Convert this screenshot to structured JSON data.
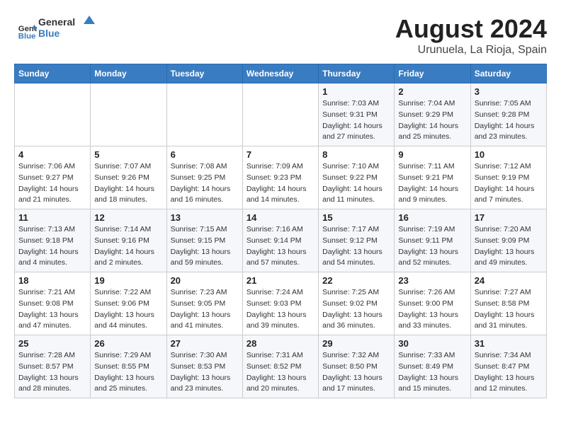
{
  "header": {
    "logo_line1": "General",
    "logo_line2": "Blue",
    "month_year": "August 2024",
    "location": "Urunuela, La Rioja, Spain"
  },
  "weekdays": [
    "Sunday",
    "Monday",
    "Tuesday",
    "Wednesday",
    "Thursday",
    "Friday",
    "Saturday"
  ],
  "weeks": [
    [
      {
        "day": "",
        "info": ""
      },
      {
        "day": "",
        "info": ""
      },
      {
        "day": "",
        "info": ""
      },
      {
        "day": "",
        "info": ""
      },
      {
        "day": "1",
        "info": "Sunrise: 7:03 AM\nSunset: 9:31 PM\nDaylight: 14 hours\nand 27 minutes."
      },
      {
        "day": "2",
        "info": "Sunrise: 7:04 AM\nSunset: 9:29 PM\nDaylight: 14 hours\nand 25 minutes."
      },
      {
        "day": "3",
        "info": "Sunrise: 7:05 AM\nSunset: 9:28 PM\nDaylight: 14 hours\nand 23 minutes."
      }
    ],
    [
      {
        "day": "4",
        "info": "Sunrise: 7:06 AM\nSunset: 9:27 PM\nDaylight: 14 hours\nand 21 minutes."
      },
      {
        "day": "5",
        "info": "Sunrise: 7:07 AM\nSunset: 9:26 PM\nDaylight: 14 hours\nand 18 minutes."
      },
      {
        "day": "6",
        "info": "Sunrise: 7:08 AM\nSunset: 9:25 PM\nDaylight: 14 hours\nand 16 minutes."
      },
      {
        "day": "7",
        "info": "Sunrise: 7:09 AM\nSunset: 9:23 PM\nDaylight: 14 hours\nand 14 minutes."
      },
      {
        "day": "8",
        "info": "Sunrise: 7:10 AM\nSunset: 9:22 PM\nDaylight: 14 hours\nand 11 minutes."
      },
      {
        "day": "9",
        "info": "Sunrise: 7:11 AM\nSunset: 9:21 PM\nDaylight: 14 hours\nand 9 minutes."
      },
      {
        "day": "10",
        "info": "Sunrise: 7:12 AM\nSunset: 9:19 PM\nDaylight: 14 hours\nand 7 minutes."
      }
    ],
    [
      {
        "day": "11",
        "info": "Sunrise: 7:13 AM\nSunset: 9:18 PM\nDaylight: 14 hours\nand 4 minutes."
      },
      {
        "day": "12",
        "info": "Sunrise: 7:14 AM\nSunset: 9:16 PM\nDaylight: 14 hours\nand 2 minutes."
      },
      {
        "day": "13",
        "info": "Sunrise: 7:15 AM\nSunset: 9:15 PM\nDaylight: 13 hours\nand 59 minutes."
      },
      {
        "day": "14",
        "info": "Sunrise: 7:16 AM\nSunset: 9:14 PM\nDaylight: 13 hours\nand 57 minutes."
      },
      {
        "day": "15",
        "info": "Sunrise: 7:17 AM\nSunset: 9:12 PM\nDaylight: 13 hours\nand 54 minutes."
      },
      {
        "day": "16",
        "info": "Sunrise: 7:19 AM\nSunset: 9:11 PM\nDaylight: 13 hours\nand 52 minutes."
      },
      {
        "day": "17",
        "info": "Sunrise: 7:20 AM\nSunset: 9:09 PM\nDaylight: 13 hours\nand 49 minutes."
      }
    ],
    [
      {
        "day": "18",
        "info": "Sunrise: 7:21 AM\nSunset: 9:08 PM\nDaylight: 13 hours\nand 47 minutes."
      },
      {
        "day": "19",
        "info": "Sunrise: 7:22 AM\nSunset: 9:06 PM\nDaylight: 13 hours\nand 44 minutes."
      },
      {
        "day": "20",
        "info": "Sunrise: 7:23 AM\nSunset: 9:05 PM\nDaylight: 13 hours\nand 41 minutes."
      },
      {
        "day": "21",
        "info": "Sunrise: 7:24 AM\nSunset: 9:03 PM\nDaylight: 13 hours\nand 39 minutes."
      },
      {
        "day": "22",
        "info": "Sunrise: 7:25 AM\nSunset: 9:02 PM\nDaylight: 13 hours\nand 36 minutes."
      },
      {
        "day": "23",
        "info": "Sunrise: 7:26 AM\nSunset: 9:00 PM\nDaylight: 13 hours\nand 33 minutes."
      },
      {
        "day": "24",
        "info": "Sunrise: 7:27 AM\nSunset: 8:58 PM\nDaylight: 13 hours\nand 31 minutes."
      }
    ],
    [
      {
        "day": "25",
        "info": "Sunrise: 7:28 AM\nSunset: 8:57 PM\nDaylight: 13 hours\nand 28 minutes."
      },
      {
        "day": "26",
        "info": "Sunrise: 7:29 AM\nSunset: 8:55 PM\nDaylight: 13 hours\nand 25 minutes."
      },
      {
        "day": "27",
        "info": "Sunrise: 7:30 AM\nSunset: 8:53 PM\nDaylight: 13 hours\nand 23 minutes."
      },
      {
        "day": "28",
        "info": "Sunrise: 7:31 AM\nSunset: 8:52 PM\nDaylight: 13 hours\nand 20 minutes."
      },
      {
        "day": "29",
        "info": "Sunrise: 7:32 AM\nSunset: 8:50 PM\nDaylight: 13 hours\nand 17 minutes."
      },
      {
        "day": "30",
        "info": "Sunrise: 7:33 AM\nSunset: 8:49 PM\nDaylight: 13 hours\nand 15 minutes."
      },
      {
        "day": "31",
        "info": "Sunrise: 7:34 AM\nSunset: 8:47 PM\nDaylight: 13 hours\nand 12 minutes."
      }
    ]
  ]
}
